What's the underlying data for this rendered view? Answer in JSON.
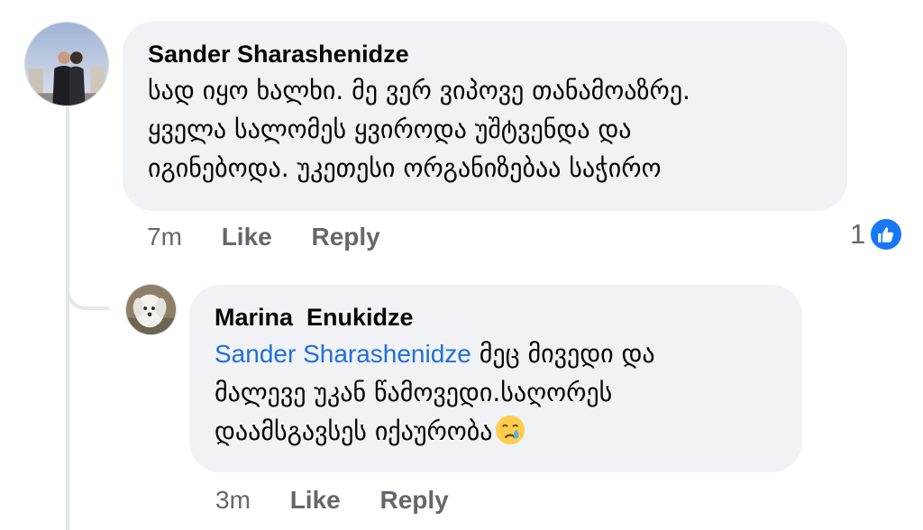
{
  "comments": [
    {
      "author": "Sander Sharashenidze",
      "lines": [
        "სად იყო ხალხი. მე ვერ ვიპოვე თანამოაზრე.",
        "ყველა სალომეს ყვიროდა უშტვენდა და",
        "იგინებოდა. უკეთესი ორგანიზებაა საჭირო"
      ],
      "time": "7m",
      "like_label": "Like",
      "reply_label": "Reply",
      "reaction_count": "1",
      "reaction_icon": "like-reaction-icon"
    }
  ],
  "reply": {
    "author": "Marina  Enukidze",
    "mention": "Sander Sharashenidze",
    "line1_rest": " მეც  მივედი და",
    "line2": "მალევე უკან  წამოვედი.საღორეს",
    "line3": "დაამსგავსეს იქაურობა",
    "emoji": "crying-face-emoji",
    "time": "3m",
    "like_label": "Like",
    "reply_label": "Reply"
  },
  "colors": {
    "bubble": "#f0f2f5",
    "mention": "#216fdb",
    "meta": "#65676b",
    "like_blue": "#1877f2"
  }
}
